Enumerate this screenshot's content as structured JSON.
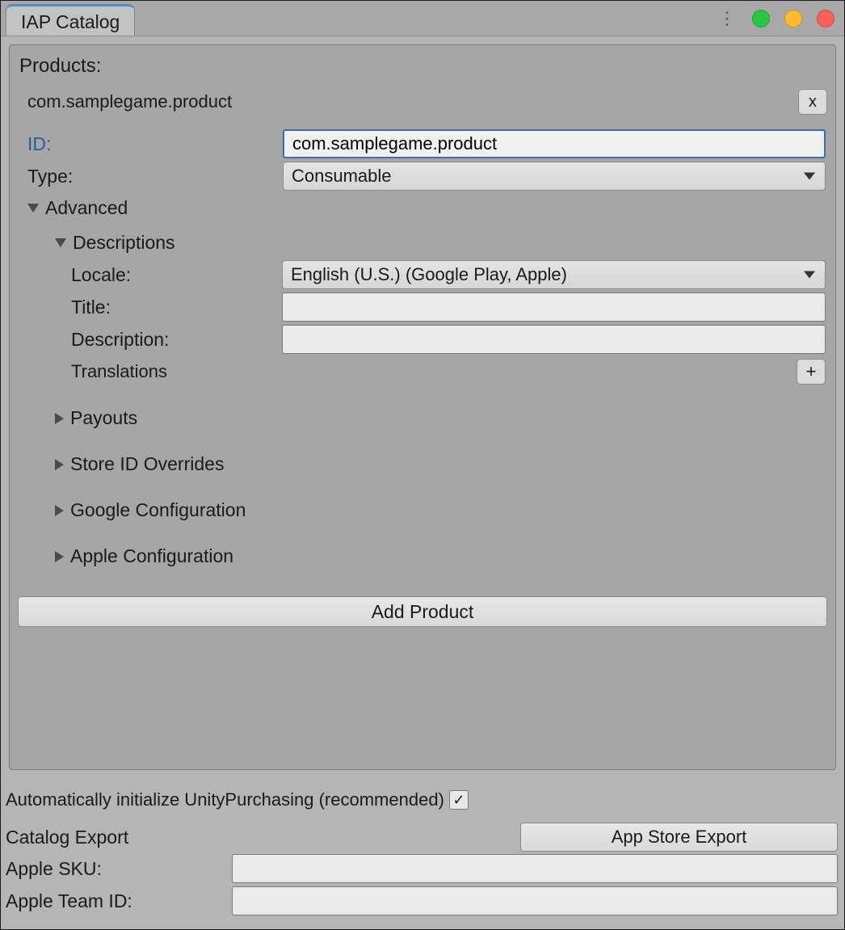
{
  "window": {
    "tab_title": "IAP Catalog"
  },
  "products": {
    "heading": "Products:",
    "item_name": "com.samplegame.product",
    "close_btn_label": "x",
    "id_label": "ID:",
    "id_value": "com.samplegame.product",
    "type_label": "Type:",
    "type_value": "Consumable",
    "advanced_label": "Advanced",
    "descriptions_label": "Descriptions",
    "locale_label": "Locale:",
    "locale_value": "English (U.S.) (Google Play, Apple)",
    "title_label": "Title:",
    "title_value": "",
    "description_label": "Description:",
    "description_value": "",
    "translations_label": "Translations",
    "plus_label": "+",
    "foldouts": {
      "payouts": "Payouts",
      "store_id_overrides": "Store ID Overrides",
      "google_config": "Google Configuration",
      "apple_config": "Apple Configuration"
    },
    "add_product_label": "Add Product"
  },
  "footer": {
    "auto_init_label": "Automatically initialize UnityPurchasing (recommended)",
    "auto_init_checked": "✓",
    "catalog_export_label": "Catalog Export",
    "app_store_export_label": "App Store Export",
    "apple_sku_label": "Apple SKU:",
    "apple_sku_value": "",
    "apple_team_id_label": "Apple Team ID:",
    "apple_team_id_value": ""
  }
}
